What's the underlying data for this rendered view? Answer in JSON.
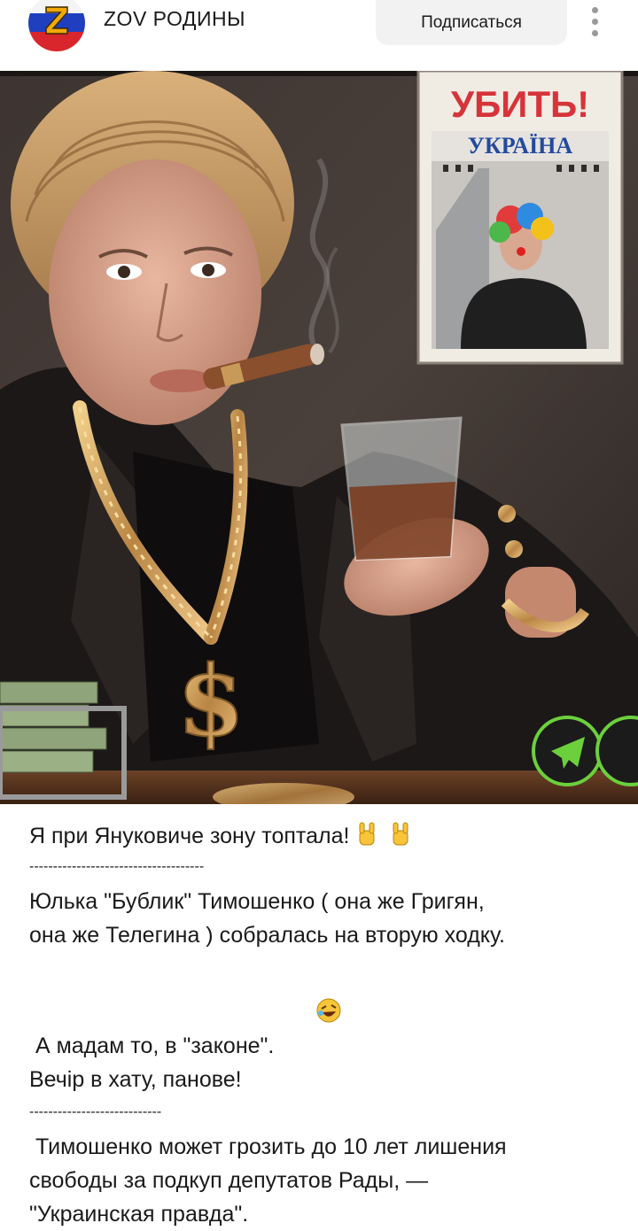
{
  "header": {
    "channel_name": "ZOV РОДИНЫ",
    "subscribe_label": "Подписаться",
    "avatar_letter": "Z"
  },
  "image": {
    "poster_title": "УБИТЬ!",
    "poster_subtitle": "УКРАЇНА",
    "watermark_icon": "telegram-icon"
  },
  "post": {
    "line1": "Я при Януковиче зону топтала!",
    "separator1": "-------------------------------------",
    "para1_line1": "Юлька \"Бублик\" Тимошенко ( она же Григян,",
    "para1_line2": "она же Телегина ) собралась на вторую ходку.",
    "para2_line1": " А мадам то, в \"законе\".",
    "para2_line2": "Вечір в хату, панове!",
    "separator2": "----------------------------",
    "para3_line1": " Тимошенко может грозить до 10 лет лишения",
    "para3_line2": "свободы за подкуп депутатов Рады, —",
    "para3_line3": "\"Украинская правда\"."
  },
  "emoji": {
    "rock_hand": "rock-hand-emoji",
    "laughing": "rolling-laughing-emoji"
  }
}
